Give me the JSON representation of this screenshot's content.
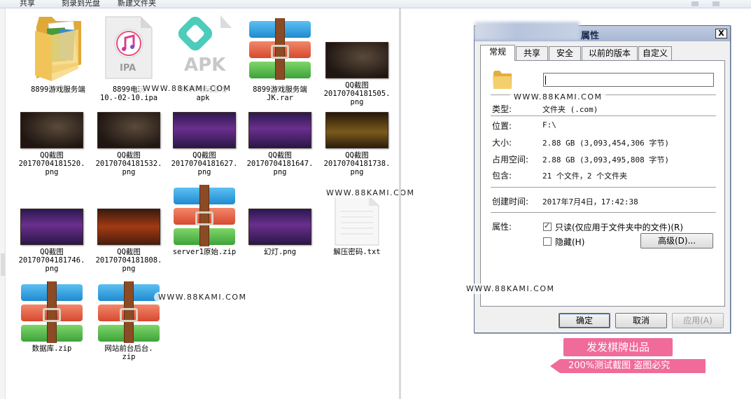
{
  "toolbar": {
    "items": [
      "共享",
      "刻录到光盘",
      "新建文件夹"
    ]
  },
  "files": [
    {
      "name": "8899游戏服务端",
      "kind": "folder"
    },
    {
      "name": "8899电玩\n10.-02-10.ipa",
      "kind": "ipa",
      "icon_text": "IPA"
    },
    {
      "name": "8899电玩游戏\napk",
      "kind": "apk",
      "icon_text": "APK"
    },
    {
      "name": "8899游戏服务端\nJK.rar",
      "kind": "rar"
    },
    {
      "name": "QQ截图\n20170704181505.\npng",
      "kind": "png"
    },
    {
      "name": "QQ截图\n20170704181520.\npng",
      "kind": "png"
    },
    {
      "name": "QQ截图\n20170704181532.\npng",
      "kind": "png"
    },
    {
      "name": "QQ截图\n20170704181627.\npng",
      "kind": "png"
    },
    {
      "name": "QQ截图\n20170704181647.\npng",
      "kind": "png"
    },
    {
      "name": "QQ截图\n20170704181738.\npng",
      "kind": "png"
    },
    {
      "name": "QQ截图\n20170704181746.\npng",
      "kind": "png"
    },
    {
      "name": "QQ截图\n20170704181808.\npng",
      "kind": "png"
    },
    {
      "name": "server1原始.zip",
      "kind": "rar"
    },
    {
      "name": "幻灯.png",
      "kind": "png"
    },
    {
      "name": "解压密码.txt",
      "kind": "txt"
    },
    {
      "name": "数据库.zip",
      "kind": "rar"
    },
    {
      "name": "网站前台后台.\nzip",
      "kind": "rar"
    }
  ],
  "watermark": "WWW.88KAMI.COM",
  "dialog": {
    "title": "属性",
    "close_label": "X",
    "tabs": [
      "常规",
      "共享",
      "安全",
      "以前的版本",
      "自定义"
    ],
    "name_value": "",
    "rows": [
      {
        "label": "类型:",
        "value": "文件夹 (.com)"
      },
      {
        "label": "位置:",
        "value": "F:\\"
      },
      {
        "label": "大小:",
        "value": "2.88 GB (3,093,454,306 字节)"
      },
      {
        "label": "占用空间:",
        "value": "2.88 GB (3,093,495,808 字节)"
      },
      {
        "label": "包含:",
        "value": "21 个文件，2 个文件夹"
      }
    ],
    "created": {
      "label": "创建时间:",
      "value": "2017年7月4日，17:42:38"
    },
    "attributes": {
      "label": "属性:",
      "readonly_label": "只读(仅应用于文件夹中的文件)(R)",
      "hidden_label": "隐藏(H)",
      "advanced_label": "高级(D)..."
    },
    "buttons": {
      "ok": "确定",
      "cancel": "取消",
      "apply": "应用(A)"
    }
  },
  "promo": {
    "top": "发发棋牌出品",
    "bottom": "200%测试截图 盗图必究"
  }
}
